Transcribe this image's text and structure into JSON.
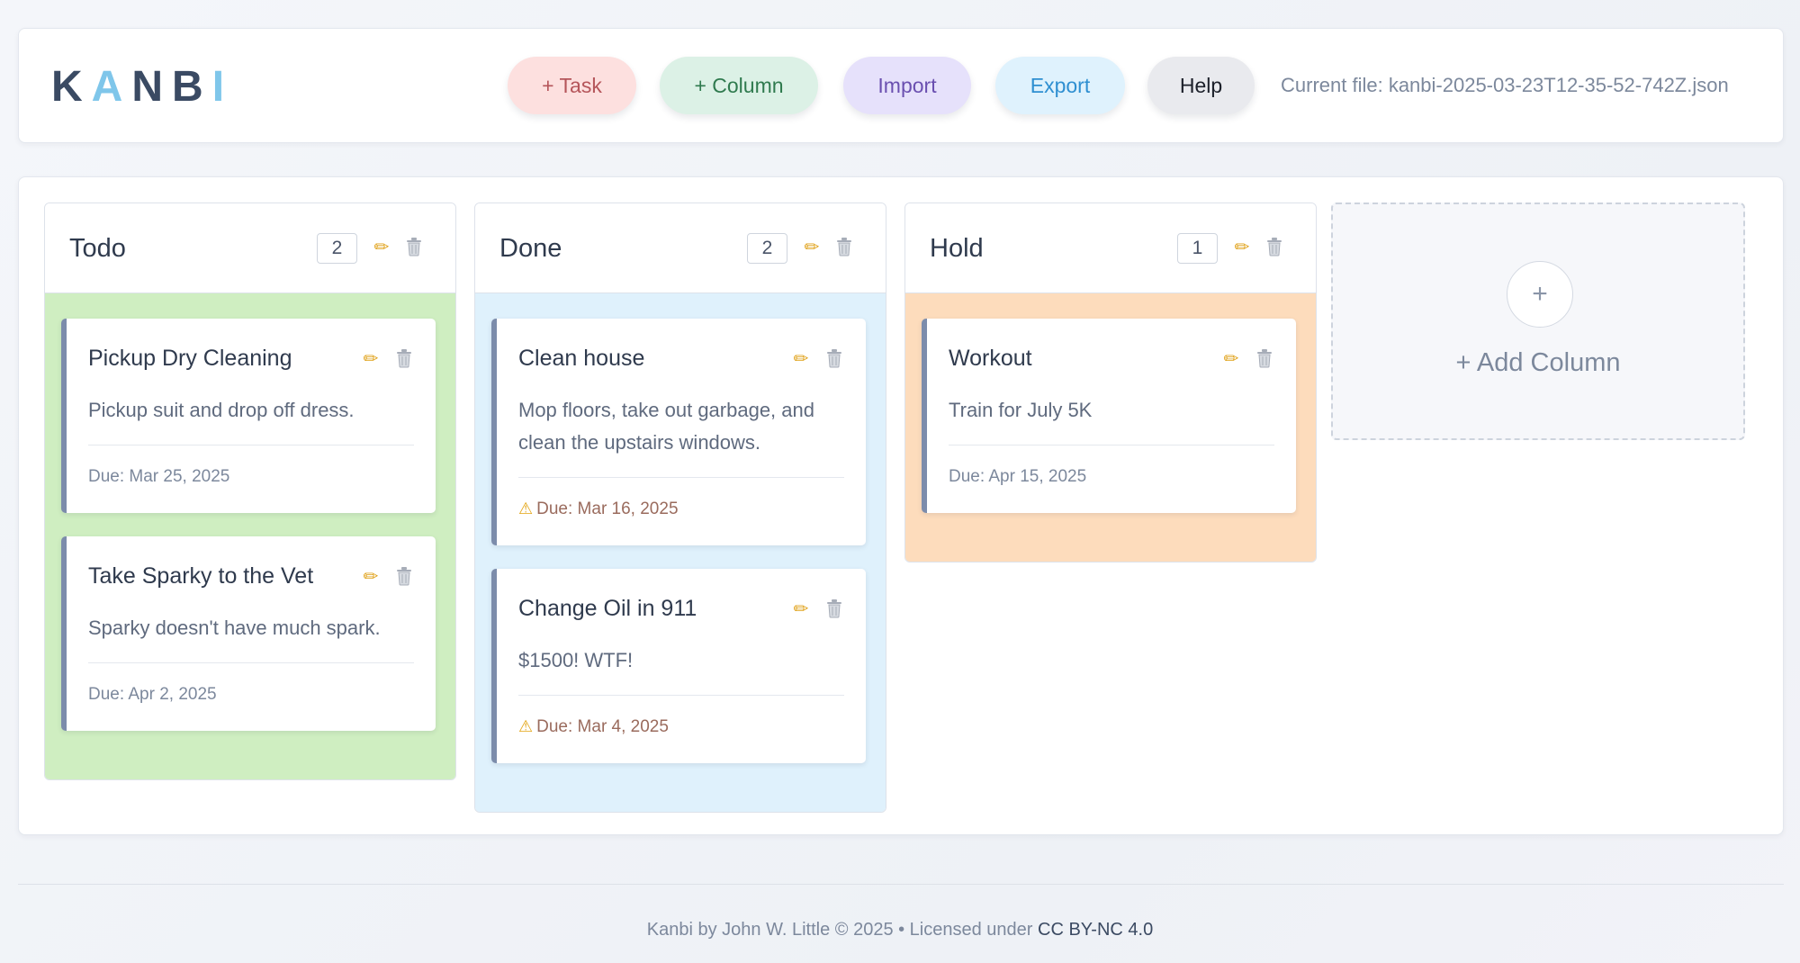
{
  "header": {
    "logo_letters": [
      {
        "char": "K",
        "color": "#3a4a63"
      },
      {
        "char": "A",
        "color": "#7fc6ea"
      },
      {
        "char": "N",
        "color": "#3a4a63"
      },
      {
        "char": "B",
        "color": "#3a4a63"
      },
      {
        "char": "I",
        "color": "#7fc6ea"
      }
    ],
    "buttons": {
      "task": "+ Task",
      "column": "+ Column",
      "import": "Import",
      "export": "Export",
      "help": "Help"
    },
    "current_file": "Current file: kanbi-2025-03-23T12-35-52-742Z.json"
  },
  "columns": [
    {
      "title": "Todo",
      "count": "2",
      "body_color": "#cfeec1",
      "cards": [
        {
          "title": "Pickup Dry Cleaning",
          "description": "Pickup suit and drop off dress.",
          "due": "Due: Mar 25, 2025",
          "overdue": false
        },
        {
          "title": "Take Sparky to the Vet",
          "description": "Sparky doesn't have much spark.",
          "due": "Due: Apr 2, 2025",
          "overdue": false
        }
      ]
    },
    {
      "title": "Done",
      "count": "2",
      "body_color": "#dff1fc",
      "cards": [
        {
          "title": "Clean house",
          "description": "Mop floors, take out garbage, and clean the upstairs windows.",
          "due": "Due: Mar 16, 2025",
          "overdue": true
        },
        {
          "title": "Change Oil in 911",
          "description": "$1500! WTF!",
          "due": "Due: Mar 4, 2025",
          "overdue": true
        }
      ]
    },
    {
      "title": "Hold",
      "count": "1",
      "body_color": "#fddcbc",
      "cards": [
        {
          "title": "Workout",
          "description": "Train for July 5K",
          "due": "Due: Apr 15, 2025",
          "overdue": false
        }
      ]
    }
  ],
  "add_column": {
    "icon": "+",
    "label": "+ Add Column"
  },
  "footer": {
    "text": "Kanbi by John W. Little © 2025 • Licensed under",
    "link": "CC BY-NC 4.0"
  },
  "icons": {
    "edit": "pencil-icon",
    "delete": "trash-icon",
    "warning": "warning-icon"
  }
}
